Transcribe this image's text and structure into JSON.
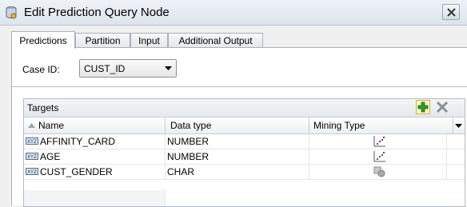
{
  "window": {
    "title": "Edit Prediction Query Node"
  },
  "tabs": [
    {
      "label": "Predictions",
      "active": true
    },
    {
      "label": "Partition",
      "active": false
    },
    {
      "label": "Input",
      "active": false
    },
    {
      "label": "Additional Output",
      "active": false
    }
  ],
  "case_id": {
    "label": "Case ID:",
    "selected": "CUST_ID"
  },
  "targets": {
    "title": "Targets",
    "columns": [
      "Name",
      "Data type",
      "Mining Type"
    ],
    "rows": [
      {
        "name": "AFFINITY_CARD",
        "data_type": "NUMBER",
        "mining_type_icon": "numerical-scatter-icon"
      },
      {
        "name": "AGE",
        "data_type": "NUMBER",
        "mining_type_icon": "numerical-scatter-icon"
      },
      {
        "name": "CUST_GENDER",
        "data_type": "CHAR",
        "mining_type_icon": "categorical-shapes-icon"
      }
    ]
  },
  "icons": {
    "app": "database-node-icon",
    "close": "close-icon",
    "add": "add-plus-icon",
    "remove": "remove-x-icon",
    "sort": "sort-ascending-icon",
    "row_type": "xyz-attribute-icon"
  },
  "colors": {
    "add_green": "#2e9a2a",
    "title_bg": "#dde4ed",
    "header_bg": "#e4e8ec"
  }
}
